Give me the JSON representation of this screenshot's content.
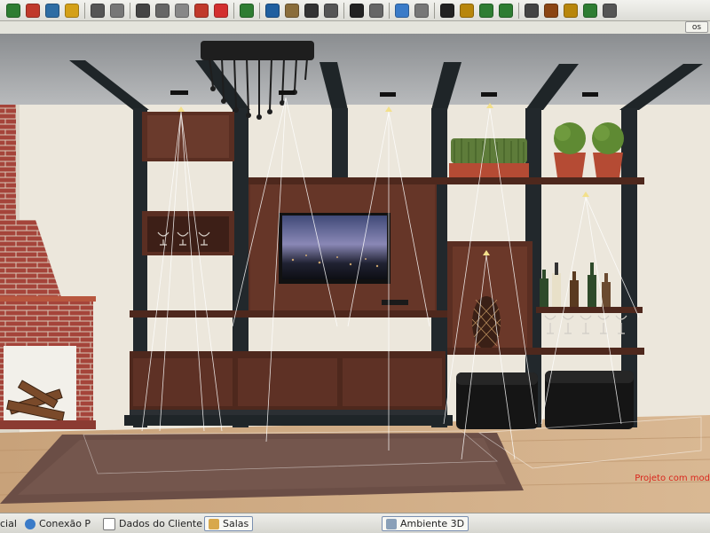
{
  "toolbar": {
    "icons": [
      "tree-icon",
      "palette-icon",
      "paint-bucket-icon",
      "component-icon",
      "undo-icon",
      "redo-icon",
      "cut-icon",
      "copy-icon",
      "paste-icon",
      "eraser-icon",
      "delete-icon",
      "price-icon",
      "layers-icon",
      "group-icon",
      "rectangle-icon",
      "text-icon",
      "select-arrow-icon",
      "measure-icon",
      "cube-icon",
      "orbit-icon",
      "eye-icon",
      "materials-icon",
      "back-arrow-icon",
      "forward-arrow-icon",
      "window-icon",
      "box-icon",
      "paint-icon",
      "camera-icon",
      "settings-icon"
    ],
    "accent": "#2e7d32"
  },
  "tabstrip": {
    "right_label": "os"
  },
  "scene": {
    "watermark": "Projeto com mod",
    "colors": {
      "wall": "#ece7dc",
      "wood": "#5a2e22",
      "beam": "#1f2528",
      "floor": "#c9a77c",
      "rug": "#6b4e46",
      "brick": "#a5443a"
    }
  },
  "statusbar": {
    "tabs": [
      {
        "label": "cial",
        "icon": "none"
      },
      {
        "label": "Conexão P",
        "icon": "connection-icon"
      },
      {
        "label": "Dados do Cliente",
        "icon": "document-icon"
      },
      {
        "label": "Salas",
        "icon": "room-icon"
      },
      {
        "label": "Ambiente 3D",
        "icon": "3d-icon"
      }
    ]
  }
}
